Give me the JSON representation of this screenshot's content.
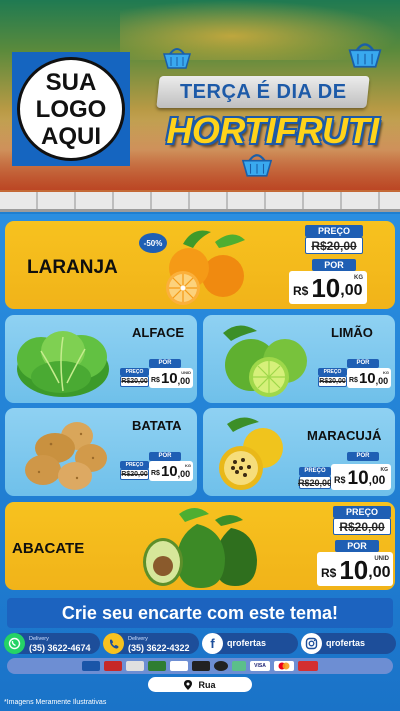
{
  "header": {
    "logo_lines": [
      "SUA",
      "LOGO",
      "AQUI"
    ],
    "title_top": "TERÇA É DIA DE",
    "title_main": "HORTIFRUTI"
  },
  "products": [
    {
      "name": "LARANJA",
      "badge": "-50%",
      "preco_label": "PREÇO",
      "old_price": "R$20,00",
      "por_label": "POR",
      "currency": "R$",
      "price_int": "10",
      "price_dec": ",00",
      "unit": "KG"
    },
    {
      "name": "ALFACE",
      "preco_label": "PREÇO",
      "old_price": "R$20,00",
      "por_label": "POR",
      "currency": "R$",
      "price_int": "10",
      "price_dec": ",00",
      "unit": "UNID"
    },
    {
      "name": "LIMÃO",
      "preco_label": "PREÇO",
      "old_price": "R$20,00",
      "por_label": "POR",
      "currency": "R$",
      "price_int": "10",
      "price_dec": ",00",
      "unit": "KG"
    },
    {
      "name": "BATATA",
      "preco_label": "PREÇO",
      "old_price": "R$20,00",
      "por_label": "POR",
      "currency": "R$",
      "price_int": "10",
      "price_dec": ",00",
      "unit": "KG"
    },
    {
      "name": "MARACUJÁ",
      "preco_label": "PREÇO",
      "old_price": "R$20,00",
      "por_label": "POR",
      "currency": "R$",
      "price_int": "10",
      "price_dec": ",00",
      "unit": "KG"
    },
    {
      "name": "ABACATE",
      "preco_label": "PREÇO",
      "old_price": "R$20,00",
      "por_label": "POR",
      "currency": "R$",
      "price_int": "10",
      "price_dec": ",00",
      "unit": "UNID"
    }
  ],
  "cta": "Crie seu encarte com este tema!",
  "contacts": [
    {
      "icon": "whatsapp-icon",
      "label": "Delivery",
      "value": "(35) 3622-4674",
      "color": "#25d366"
    },
    {
      "icon": "phone-icon",
      "label": "Delivery",
      "value": "(35) 3622-4322",
      "color": "#f7c21f"
    },
    {
      "icon": "facebook-icon",
      "value": "qrofertas",
      "color": "#ffffff"
    },
    {
      "icon": "instagram-icon",
      "value": "qrofertas",
      "color": "#ffffff"
    }
  ],
  "payments": [
    "VISA"
  ],
  "address": "Rua",
  "disclaimer": "*Imagens Meramente Ilustrativas"
}
